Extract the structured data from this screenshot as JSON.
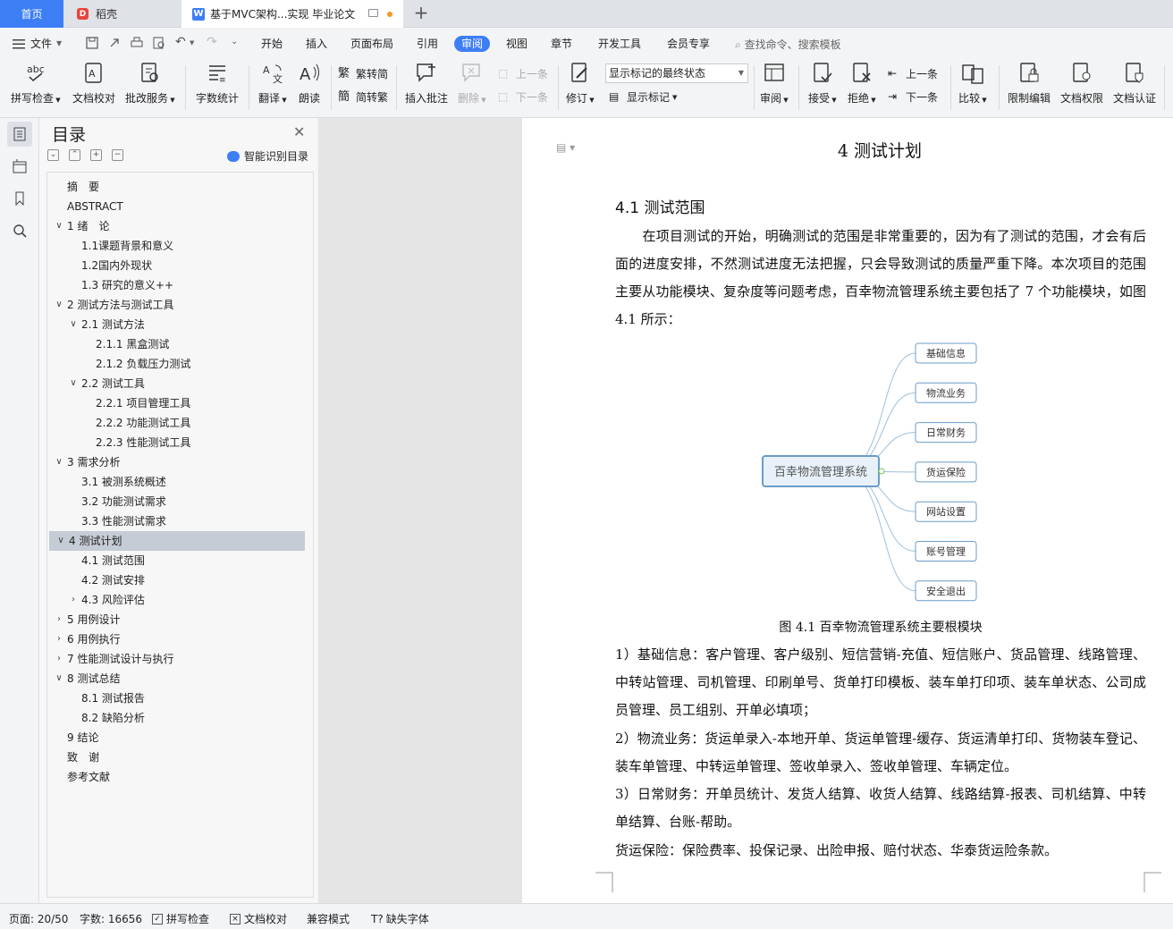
{
  "tabs": {
    "home": "首页",
    "daoke": "稻壳",
    "doc": "基于MVC架构...实现 毕业论文"
  },
  "menu": {
    "file": "文件",
    "items": [
      "开始",
      "插入",
      "页面布局",
      "引用",
      "审阅",
      "视图",
      "章节",
      "开发工具",
      "会员专享"
    ],
    "active": "审阅",
    "search": "查找命令、搜索模板"
  },
  "ribbon": {
    "spellcheck": "拼写检查",
    "doc_proof": "文档校对",
    "batch_service": "批改服务",
    "word_count": "字数统计",
    "translate": "翻译",
    "read_aloud": "朗读",
    "trad_to_simp": "繁转简",
    "simp_to_trad": "简转繁",
    "insert_comment": "插入批注",
    "delete": "删除",
    "prev_comment": "上一条",
    "next_comment": "下一条",
    "revise": "修订",
    "markup_state": "显示标记的最终状态",
    "show_markup": "显示标记",
    "review": "审阅",
    "accept": "接受",
    "reject": "拒绝",
    "prev_change": "上一条",
    "next_change": "下一条",
    "compare": "比较",
    "restrict_edit": "限制编辑",
    "doc_permission": "文档权限",
    "doc_certify": "文档认证"
  },
  "toc": {
    "title": "目录",
    "smart_recognize": "智能识别目录",
    "items": [
      {
        "label": "摘　要",
        "level": 0,
        "chev": ""
      },
      {
        "label": "ABSTRACT",
        "level": 0,
        "chev": ""
      },
      {
        "label": "1  绪　论",
        "level": 0,
        "chev": "down"
      },
      {
        "label": "1.1课题背景和意义",
        "level": 1,
        "chev": ""
      },
      {
        "label": "1.2国内外现状",
        "level": 1,
        "chev": ""
      },
      {
        "label": "1.3  研究的意义++",
        "level": 1,
        "chev": ""
      },
      {
        "label": "2  测试方法与测试工具",
        "level": 0,
        "chev": "down"
      },
      {
        "label": "2.1 测试方法",
        "level": 1,
        "chev": "down"
      },
      {
        "label": "2.1.1 黑盒测试",
        "level": 2,
        "chev": ""
      },
      {
        "label": "2.1.2 负载压力测试",
        "level": 2,
        "chev": ""
      },
      {
        "label": "2.2 测试工具",
        "level": 1,
        "chev": "down"
      },
      {
        "label": "2.2.1 项目管理工具",
        "level": 2,
        "chev": ""
      },
      {
        "label": "2.2.2 功能测试工具",
        "level": 2,
        "chev": ""
      },
      {
        "label": "2.2.3 性能测试工具",
        "level": 2,
        "chev": ""
      },
      {
        "label": "3  需求分析",
        "level": 0,
        "chev": "down"
      },
      {
        "label": "3.1 被测系统概述",
        "level": 1,
        "chev": ""
      },
      {
        "label": "3.2 功能测试需求",
        "level": 1,
        "chev": ""
      },
      {
        "label": "3.3 性能测试需求",
        "level": 1,
        "chev": ""
      },
      {
        "label": "4  测试计划",
        "level": 0,
        "chev": "down",
        "active": true
      },
      {
        "label": "4.1 测试范围",
        "level": 1,
        "chev": ""
      },
      {
        "label": "4.2 测试安排",
        "level": 1,
        "chev": ""
      },
      {
        "label": "4.3 风险评估",
        "level": 1,
        "chev": "right"
      },
      {
        "label": "5  用例设计",
        "level": 0,
        "chev": "right"
      },
      {
        "label": "6  用例执行",
        "level": 0,
        "chev": "right"
      },
      {
        "label": "7  性能测试设计与执行",
        "level": 0,
        "chev": "right"
      },
      {
        "label": "8  测试总结",
        "level": 0,
        "chev": "down"
      },
      {
        "label": "8.1 测试报告",
        "level": 1,
        "chev": ""
      },
      {
        "label": "8.2 缺陷分析",
        "level": 1,
        "chev": ""
      },
      {
        "label": "9  结论",
        "level": 0,
        "chev": ""
      },
      {
        "label": "致　谢",
        "level": 0,
        "chev": ""
      },
      {
        "label": "参考文献",
        "level": 0,
        "chev": ""
      }
    ]
  },
  "document": {
    "chapter_title": "4  测试计划",
    "section_title": "4.1 测试范围",
    "intro": "　　在项目测试的开始，明确测试的范围是非常重要的，因为有了测试的范围，才会有后面的进度安排，不然测试进度无法把握，只会导致测试的质量严重下降。本次项目的范围主要从功能模块、复杂度等问题考虑，百幸物流管理系统主要包括了 7 个功能模块，如图 4.1 所示：",
    "diagram": {
      "root": "百幸物流管理系统",
      "children": [
        "基础信息",
        "物流业务",
        "日常财务",
        "货运保险",
        "网站设置",
        "账号管理",
        "安全退出"
      ]
    },
    "caption": "图 4.1  百幸物流管理系统主要根模块",
    "list": [
      "1）基础信息：客户管理、客户级别、短信营销-充值、短信账户、货品管理、线路管理、中转站管理、司机管理、印刷单号、货单打印模板、装车单打印项、装车单状态、公司成员管理、员工组别、开单必填项；",
      "2）物流业务：货运单录入-本地开单、货运单管理-缓存、货运清单打印、货物装车登记、装车单管理、中转运单管理、签收单录入、签收单管理、车辆定位。",
      "3）日常财务：开单员统计、发货人结算、收货人结算、线路结算-报表、司机结算、中转单结算、台账-帮助。",
      "货运保险：保险费率、投保记录、出险申报、赔付状态、华泰货运险条款。"
    ]
  },
  "status": {
    "page": "页面: 20/50",
    "words": "字数: 16656",
    "spellcheck": "拼写检查",
    "proof": "文档校对",
    "compat": "兼容模式",
    "missing_font": "缺失字体"
  },
  "colors": {
    "accent": "#3d7ef5",
    "node_border": "#6a9cc9",
    "root_fill": "#e8f1fa"
  }
}
